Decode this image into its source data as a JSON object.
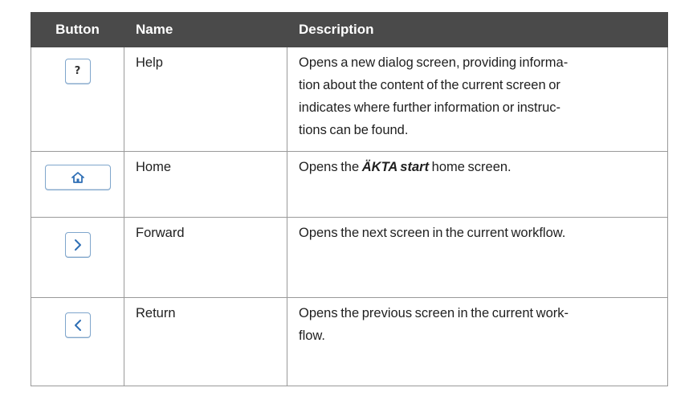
{
  "table": {
    "headers": [
      "Button",
      "Name",
      "Description"
    ],
    "rows": [
      {
        "icon": "question-mark-icon",
        "button_glyph": "?",
        "name": "Help",
        "description_lines": [
          "Opens a new dialog screen, providing informa-",
          "tion about the content of the current screen or",
          "indicates where further information or instruc-",
          "tions can be found."
        ]
      },
      {
        "icon": "home-icon",
        "name": "Home",
        "description_prefix": "Opens the ",
        "description_product": "ÄKTA start",
        "description_suffix": " home screen."
      },
      {
        "icon": "chevron-right-icon",
        "name": "Forward",
        "description_lines": [
          "Opens the next screen in the current workflow."
        ]
      },
      {
        "icon": "chevron-left-icon",
        "name": "Return",
        "description_lines": [
          "Opens the previous screen in the current work-",
          "flow."
        ]
      }
    ]
  },
  "colors": {
    "header_bg": "#4a4a4a",
    "header_text": "#ffffff",
    "button_border": "#7fa6cc",
    "icon_blue": "#2f6fb5"
  }
}
